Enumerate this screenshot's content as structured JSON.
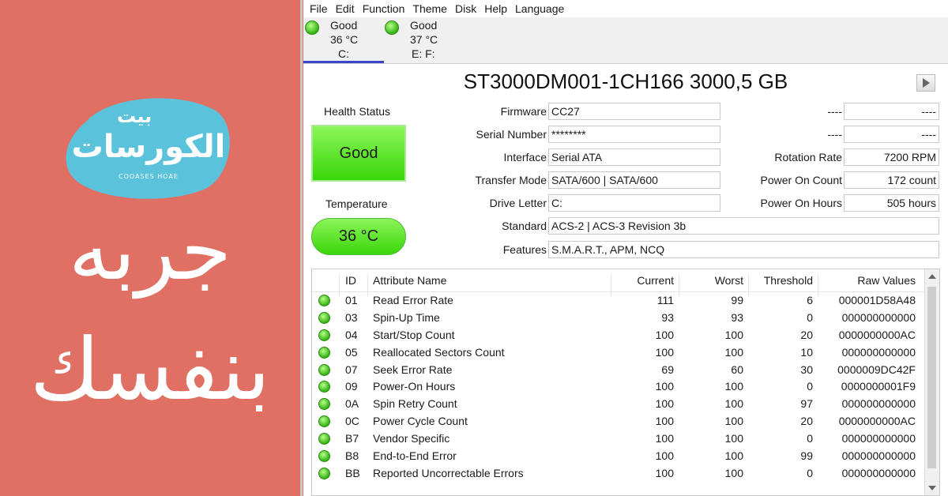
{
  "banner": {
    "logo_top": "بيت",
    "logo_main": "الكورسات",
    "logo_sub": "COOASES HOAE",
    "line1": "جربه",
    "line2": "بنفسك"
  },
  "menu": [
    "File",
    "Edit",
    "Function",
    "Theme",
    "Disk",
    "Help",
    "Language"
  ],
  "drives": [
    {
      "status": "Good",
      "temp": "36 °C",
      "letter": "C:"
    },
    {
      "status": "Good",
      "temp": "37 °C",
      "letter": "E: F:"
    }
  ],
  "disk_title": "ST3000DM001-1CH166 3000,5 GB",
  "health": {
    "label": "Health Status",
    "value": "Good"
  },
  "temperature": {
    "label": "Temperature",
    "value": "36 °C"
  },
  "fields": [
    {
      "label": "Firmware",
      "value": "CC27"
    },
    {
      "label": "Serial Number",
      "value": "********"
    },
    {
      "label": "Interface",
      "value": "Serial ATA"
    },
    {
      "label": "Transfer Mode",
      "value": "SATA/600 | SATA/600"
    },
    {
      "label": "Drive Letter",
      "value": "C:"
    },
    {
      "label": "Standard",
      "value": "ACS-2 | ACS-3 Revision 3b"
    },
    {
      "label": "Features",
      "value": "S.M.A.R.T., APM, NCQ"
    }
  ],
  "right_fields": [
    {
      "label": "----",
      "value": "----"
    },
    {
      "label": "----",
      "value": "----"
    },
    {
      "label": "Rotation Rate",
      "value": "7200 RPM"
    },
    {
      "label": "Power On Count",
      "value": "172 count"
    },
    {
      "label": "Power On Hours",
      "value": "505 hours"
    }
  ],
  "table": {
    "headers": [
      "ID",
      "Attribute Name",
      "Current",
      "Worst",
      "Threshold",
      "Raw Values"
    ],
    "rows": [
      [
        "01",
        "Read Error Rate",
        "111",
        "99",
        "6",
        "000001D58A48"
      ],
      [
        "03",
        "Spin-Up Time",
        "93",
        "93",
        "0",
        "000000000000"
      ],
      [
        "04",
        "Start/Stop Count",
        "100",
        "100",
        "20",
        "0000000000AC"
      ],
      [
        "05",
        "Reallocated Sectors Count",
        "100",
        "100",
        "10",
        "000000000000"
      ],
      [
        "07",
        "Seek Error Rate",
        "69",
        "60",
        "30",
        "0000009DC42F"
      ],
      [
        "09",
        "Power-On Hours",
        "100",
        "100",
        "0",
        "0000000001F9"
      ],
      [
        "0A",
        "Spin Retry Count",
        "100",
        "100",
        "97",
        "000000000000"
      ],
      [
        "0C",
        "Power Cycle Count",
        "100",
        "100",
        "20",
        "0000000000AC"
      ],
      [
        "B7",
        "Vendor Specific",
        "100",
        "100",
        "0",
        "000000000000"
      ],
      [
        "B8",
        "End-to-End Error",
        "100",
        "100",
        "99",
        "000000000000"
      ],
      [
        "BB",
        "Reported Uncorrectable Errors",
        "100",
        "100",
        "0",
        "000000000000"
      ]
    ]
  },
  "colors": {
    "accent": "#3a46c9",
    "good": "#3ad60a",
    "banner": "#e07064",
    "logo_blob": "#5bc2dc"
  }
}
